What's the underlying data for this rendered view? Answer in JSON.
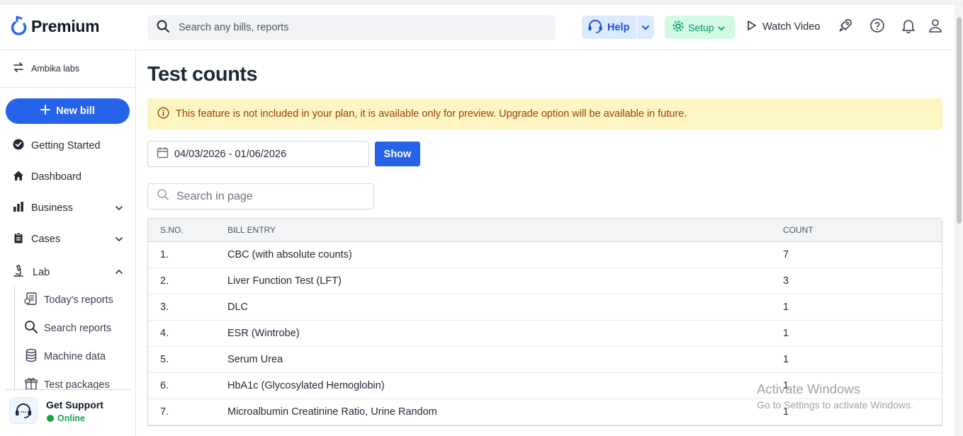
{
  "header": {
    "brand": "Premium",
    "search_placeholder": "Search any bills, reports",
    "help_label": "Help",
    "setup_label": "Setup",
    "watch_video_label": "Watch Video"
  },
  "sidebar": {
    "org_name": "Ambika labs",
    "new_bill_label": "New bill",
    "items": [
      {
        "label": "Getting Started"
      },
      {
        "label": "Dashboard"
      },
      {
        "label": "Business"
      },
      {
        "label": "Cases"
      },
      {
        "label": "Lab"
      }
    ],
    "lab_subitems": [
      {
        "label": "Today's reports"
      },
      {
        "label": "Search reports"
      },
      {
        "label": "Machine data"
      },
      {
        "label": "Test packages"
      }
    ],
    "support": {
      "title": "Get Support",
      "status": "Online"
    }
  },
  "main": {
    "title": "Test counts",
    "notice": "This feature is not included in your plan, it is available only for preview. Upgrade option will be available in future.",
    "date_range": "04/03/2026 - 01/06/2026",
    "show_label": "Show",
    "page_search_placeholder": "Search in page",
    "table": {
      "columns": [
        "S.NO.",
        "BILL ENTRY",
        "COUNT"
      ],
      "rows": [
        {
          "sno": "1.",
          "entry": "CBC (with absolute counts)",
          "count": "7"
        },
        {
          "sno": "2.",
          "entry": "Liver Function Test (LFT)",
          "count": "3"
        },
        {
          "sno": "3.",
          "entry": "DLC",
          "count": "1"
        },
        {
          "sno": "4.",
          "entry": "ESR (Wintrobe)",
          "count": "1"
        },
        {
          "sno": "5.",
          "entry": "Serum Urea",
          "count": "1"
        },
        {
          "sno": "6.",
          "entry": "HbA1c (Glycosylated Hemoglobin)",
          "count": "1"
        },
        {
          "sno": "7.",
          "entry": "Microalbumin Creatinine Ratio, Urine Random",
          "count": "1"
        }
      ]
    }
  },
  "watermark": {
    "line1": "Activate Windows",
    "line2": "Go to Settings to activate Windows."
  },
  "colors": {
    "accent": "#2563eb",
    "notice_bg": "#fdf6c3",
    "setup_bg": "#d1fae5",
    "help_bg": "#dbeafe"
  }
}
